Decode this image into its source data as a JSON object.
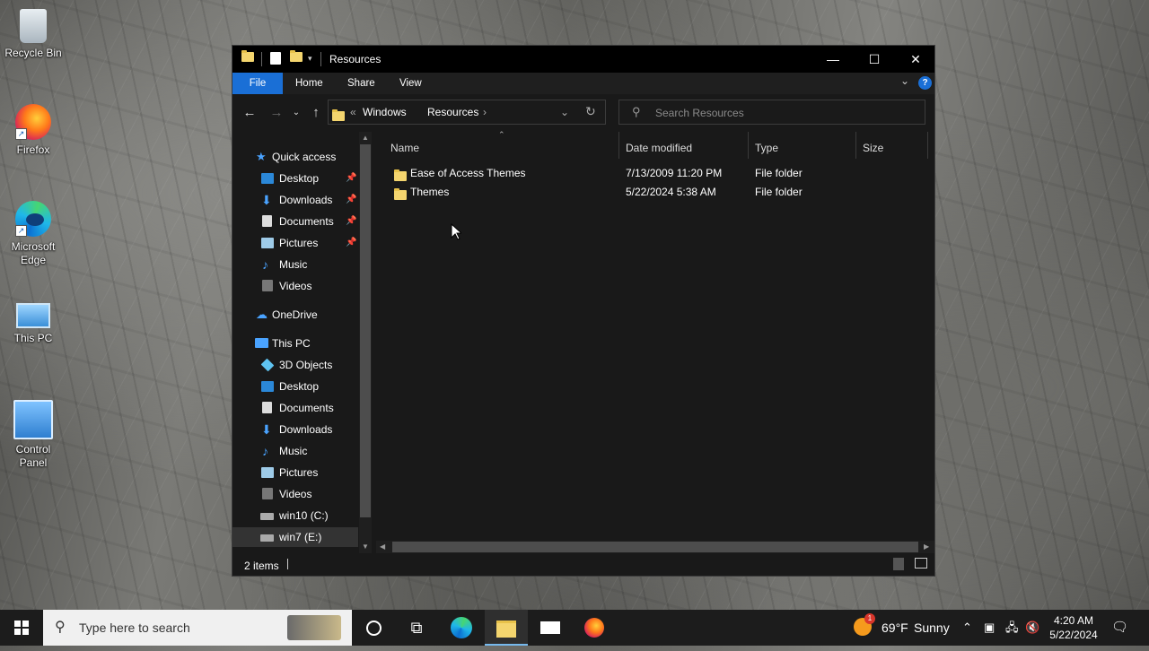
{
  "desktop": {
    "icons": [
      {
        "label": "Recycle Bin",
        "icon": "recycle-bin-icon"
      },
      {
        "label": "Firefox",
        "icon": "firefox-icon"
      },
      {
        "label": "Microsoft Edge",
        "icon": "edge-icon"
      },
      {
        "label": "This PC",
        "icon": "computer-icon"
      },
      {
        "label": "Control Panel",
        "icon": "control-panel-icon"
      }
    ]
  },
  "window": {
    "title": "Resources",
    "ribbon_tabs": [
      "File",
      "Home",
      "Share",
      "View"
    ],
    "address": {
      "chevron": "«",
      "segments": [
        "Windows",
        "Resources"
      ]
    },
    "search_placeholder": "Search Resources",
    "nav": {
      "quick_access": "Quick access",
      "quick_items": [
        "Desktop",
        "Downloads",
        "Documents",
        "Pictures",
        "Music",
        "Videos"
      ],
      "onedrive": "OneDrive",
      "this_pc": "This PC",
      "pc_items": [
        "3D Objects",
        "Desktop",
        "Documents",
        "Downloads",
        "Music",
        "Pictures",
        "Videos",
        "win10 (C:)",
        "win7 (E:)"
      ]
    },
    "columns": [
      "Name",
      "Date modified",
      "Type",
      "Size"
    ],
    "files": [
      {
        "name": "Ease of Access Themes",
        "date": "7/13/2009 11:20 PM",
        "type": "File folder",
        "size": ""
      },
      {
        "name": "Themes",
        "date": "5/22/2024 5:38 AM",
        "type": "File folder",
        "size": ""
      }
    ],
    "status": "2 items",
    "accent_color": "#1a6fd6"
  },
  "taskbar": {
    "search_placeholder": "Type here to search",
    "weather": {
      "temp": "69°F",
      "condition": "Sunny",
      "badge": "1"
    },
    "time": "4:20 AM",
    "date": "5/22/2024"
  }
}
